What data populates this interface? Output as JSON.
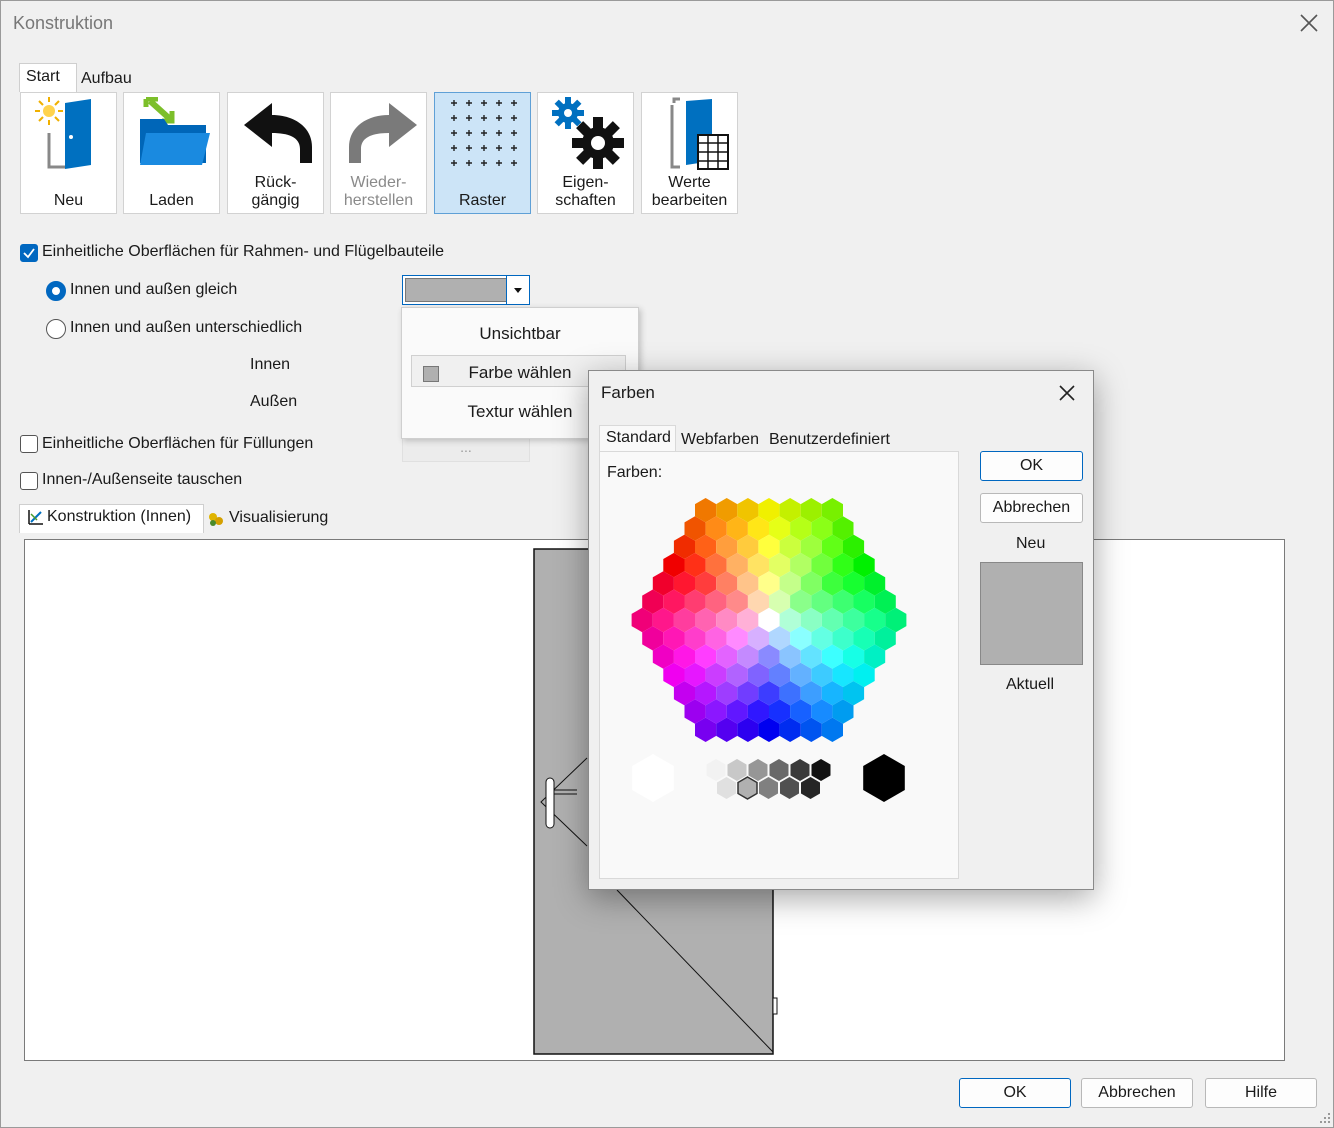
{
  "window": {
    "title": "Konstruktion"
  },
  "tabs": {
    "start": "Start",
    "aufbau": "Aufbau"
  },
  "toolbar": {
    "neu": "Neu",
    "laden": "Laden",
    "rueck_1": "Rück-",
    "rueck_2": "gängig",
    "wieder_1": "Wieder-",
    "wieder_2": "herstellen",
    "raster": "Raster",
    "eigen_1": "Eigen-",
    "eigen_2": "schaften",
    "werte_1": "Werte",
    "werte_2": "bearbeiten"
  },
  "options": {
    "einheitlich_rahmen": "Einheitliche Oberflächen für Rahmen- und Flügelbauteile",
    "gleich": "Innen und außen gleich",
    "unterschiedlich": "Innen und außen unterschiedlich",
    "innen": "Innen",
    "aussen": "Außen",
    "einheitlich_fuellungen": "Einheitliche Oberflächen für Füllungen",
    "tauschen": "Innen-/Außenseite tauschen"
  },
  "dropdown": {
    "selected_color": "#b0b0b0",
    "items": [
      "Unsichtbar",
      "Farbe wählen",
      "Textur wählen"
    ],
    "more": "..."
  },
  "view_tabs": {
    "konstruktion": "Konstruktion (Innen)",
    "visualisierung": "Visualisierung"
  },
  "footer": {
    "ok": "OK",
    "abbrechen": "Abbrechen",
    "hilfe": "Hilfe"
  },
  "colors_dialog": {
    "title": "Farben",
    "tabs": [
      "Standard",
      "Webfarben",
      "Benutzerdefiniert"
    ],
    "farben_label": "Farben:",
    "ok": "OK",
    "abbrechen": "Abbrechen",
    "neu": "Neu",
    "aktuell": "Aktuell",
    "current_color": "#b0b0b0"
  }
}
